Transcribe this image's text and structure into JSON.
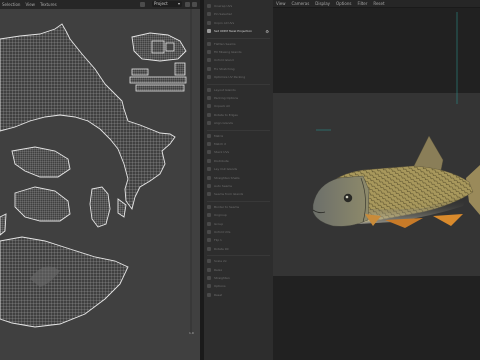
{
  "uv_editor": {
    "menu": [
      "Selection",
      "View",
      "Textures"
    ],
    "dropdown": "Project",
    "corner_label": "1.0"
  },
  "tools_panel": {
    "items": [
      {
        "label": "Unwrap UVs",
        "active": false
      },
      {
        "label": "Pin Selected",
        "active": false
      },
      {
        "label": "Unpin All UVs",
        "active": false
      },
      {
        "label": "Set UDIM Texel Projection",
        "active": true,
        "gear": true
      },
      {
        "label": "Flatten Seams",
        "active": false
      },
      {
        "label": "Fill Missing Islands",
        "active": false
      },
      {
        "label": "Unfold Island",
        "active": false
      },
      {
        "label": "Fix Stretching",
        "active": false
      },
      {
        "label": "Optimize UV Packing",
        "active": false
      },
      {
        "label": "Layout Islands",
        "active": false
      },
      {
        "label": "Packing Options",
        "active": false
      },
      {
        "label": "Unpack All",
        "active": false
      },
      {
        "label": "Rotate to Edges",
        "active": false
      },
      {
        "label": "Align Islands",
        "active": false
      },
      {
        "label": "Matrix",
        "active": false
      },
      {
        "label": "Match X",
        "active": false
      },
      {
        "label": "Stack UVs",
        "active": false
      },
      {
        "label": "Distribute",
        "active": false
      },
      {
        "label": "Lay Out Islands",
        "active": false
      },
      {
        "label": "Straighten Shells",
        "active": false
      },
      {
        "label": "Auto Seams",
        "active": false
      },
      {
        "label": "Seams from Islands",
        "active": false
      },
      {
        "label": "Border to Seams",
        "active": false
      },
      {
        "label": "Ungroup",
        "active": false
      },
      {
        "label": "Group",
        "active": false
      },
      {
        "label": "Unfold UVs",
        "active": false
      },
      {
        "label": "Flip U",
        "active": false
      },
      {
        "label": "Rotate 90",
        "active": false
      },
      {
        "label": "Scale 2x",
        "active": false
      },
      {
        "label": "Relax",
        "active": false
      },
      {
        "label": "Straighten",
        "active": false
      },
      {
        "label": "Options",
        "active": false
      },
      {
        "label": "Reset",
        "active": false
      }
    ]
  },
  "viewport": {
    "menu": [
      "View",
      "Cameras",
      "Display",
      "Options",
      "Filter",
      "Reset"
    ]
  },
  "colors": {
    "uv_background": "#404040",
    "wireframe": "#d9d9d9",
    "viewport_bg": "#343434",
    "light_line": "#2a8f8a",
    "fish_body": "#a8985c",
    "fin_orange": "#d98a2c"
  }
}
